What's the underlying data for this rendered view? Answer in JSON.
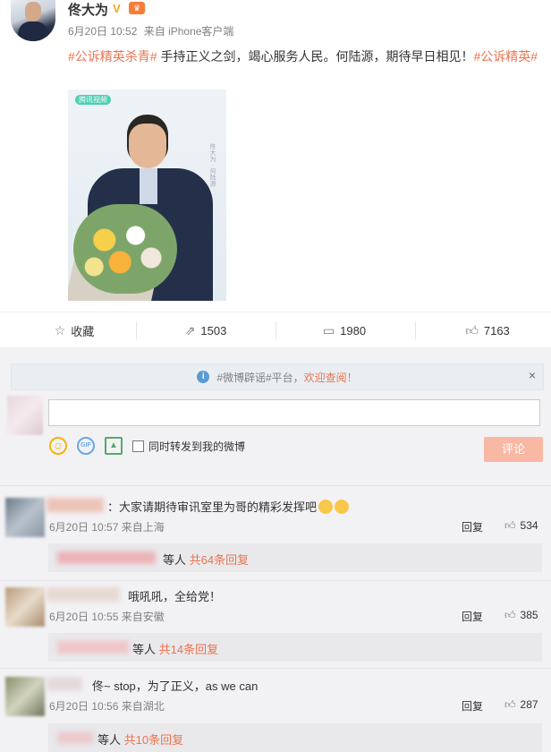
{
  "post": {
    "author": "佟大为",
    "verified_mark": "V",
    "date": "6月20日 10:52",
    "source": "来自 iPhone客户端",
    "hashtag1": "#公诉精英杀青#",
    "body": " 手持正义之剑，竭心服务人民。何陆源，期待早日相见！",
    "hashtag2": "#公诉精英#",
    "photo_logo": "腾讯视频",
    "photo_caption": "佟大为 · 何陆源"
  },
  "actions": {
    "favorite": "收藏",
    "repost_count": "1503",
    "comment_count": "1980",
    "like_count": "7163"
  },
  "notice": {
    "prefix": "#微博辟谣#平台，",
    "link": "欢迎查阅！",
    "close": "×"
  },
  "composer": {
    "placeholder": "",
    "repost_label": "同时转发到我的微博",
    "submit": "评论"
  },
  "comments": [
    {
      "text": "：大家请期待审讯室里为哥的精彩发挥吧",
      "time": "6月20日 10:57 来自上海",
      "reply_label": "回复",
      "likes": "534",
      "reply_summary": "等人",
      "reply_count": "共64条回复"
    },
    {
      "text": "哦吼吼，全给党！",
      "time": "6月20日 10:55 来自安徽",
      "reply_label": "回复",
      "likes": "385",
      "reply_summary": "等人",
      "reply_count": "共14条回复"
    },
    {
      "text": "佟~ stop，为了正义，as we can",
      "time": "6月20日 10:56 来自湖北",
      "reply_label": "回复",
      "likes": "287",
      "reply_summary": "等人",
      "reply_count": "共10条回复"
    }
  ],
  "icons": {
    "favorite": "star-icon",
    "repost": "repost-icon",
    "comment": "comment-icon",
    "like": "thumb-up-icon",
    "emoji": "emoji-icon",
    "gif": "gif-icon",
    "image": "image-icon",
    "info": "info-icon"
  },
  "colors": {
    "accent": "#eb7350",
    "submit_disabled": "#f9b8a3",
    "comment_bg": "#f2f2f5",
    "notice_info": "#5b9bd5"
  }
}
